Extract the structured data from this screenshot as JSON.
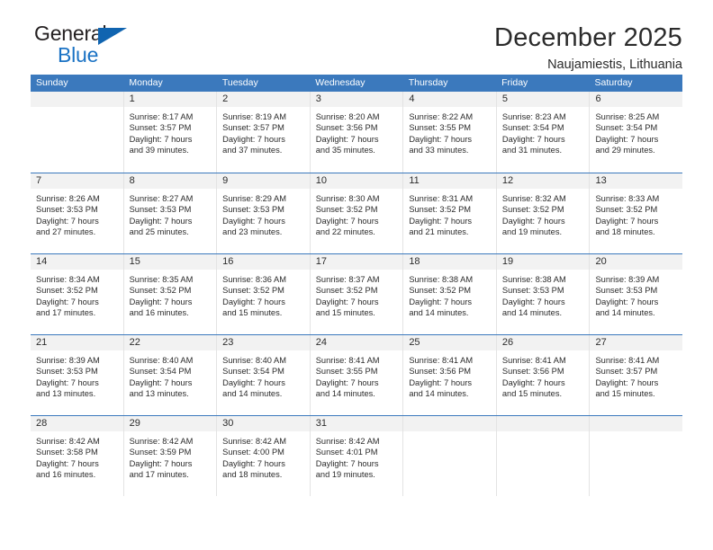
{
  "brand": {
    "name_part1": "General",
    "name_part2": "Blue",
    "triangle_icon": "triangle-icon",
    "accent_color": "#1064b0"
  },
  "header": {
    "title": "December 2025",
    "subtitle": "Naujamiestis, Lithuania"
  },
  "calendar": {
    "header_color": "#3b79bd",
    "day_band_color": "#f2f2f2",
    "weekdays": [
      "Sunday",
      "Monday",
      "Tuesday",
      "Wednesday",
      "Thursday",
      "Friday",
      "Saturday"
    ],
    "weeks": [
      {
        "days": [
          {
            "num": "",
            "empty": true,
            "sunrise": "",
            "sunset": "",
            "daylight_line1": "",
            "daylight_line2": ""
          },
          {
            "num": "1",
            "empty": false,
            "sunrise": "Sunrise: 8:17 AM",
            "sunset": "Sunset: 3:57 PM",
            "daylight_line1": "Daylight: 7 hours",
            "daylight_line2": "and 39 minutes."
          },
          {
            "num": "2",
            "empty": false,
            "sunrise": "Sunrise: 8:19 AM",
            "sunset": "Sunset: 3:57 PM",
            "daylight_line1": "Daylight: 7 hours",
            "daylight_line2": "and 37 minutes."
          },
          {
            "num": "3",
            "empty": false,
            "sunrise": "Sunrise: 8:20 AM",
            "sunset": "Sunset: 3:56 PM",
            "daylight_line1": "Daylight: 7 hours",
            "daylight_line2": "and 35 minutes."
          },
          {
            "num": "4",
            "empty": false,
            "sunrise": "Sunrise: 8:22 AM",
            "sunset": "Sunset: 3:55 PM",
            "daylight_line1": "Daylight: 7 hours",
            "daylight_line2": "and 33 minutes."
          },
          {
            "num": "5",
            "empty": false,
            "sunrise": "Sunrise: 8:23 AM",
            "sunset": "Sunset: 3:54 PM",
            "daylight_line1": "Daylight: 7 hours",
            "daylight_line2": "and 31 minutes."
          },
          {
            "num": "6",
            "empty": false,
            "sunrise": "Sunrise: 8:25 AM",
            "sunset": "Sunset: 3:54 PM",
            "daylight_line1": "Daylight: 7 hours",
            "daylight_line2": "and 29 minutes."
          }
        ]
      },
      {
        "days": [
          {
            "num": "7",
            "empty": false,
            "sunrise": "Sunrise: 8:26 AM",
            "sunset": "Sunset: 3:53 PM",
            "daylight_line1": "Daylight: 7 hours",
            "daylight_line2": "and 27 minutes."
          },
          {
            "num": "8",
            "empty": false,
            "sunrise": "Sunrise: 8:27 AM",
            "sunset": "Sunset: 3:53 PM",
            "daylight_line1": "Daylight: 7 hours",
            "daylight_line2": "and 25 minutes."
          },
          {
            "num": "9",
            "empty": false,
            "sunrise": "Sunrise: 8:29 AM",
            "sunset": "Sunset: 3:53 PM",
            "daylight_line1": "Daylight: 7 hours",
            "daylight_line2": "and 23 minutes."
          },
          {
            "num": "10",
            "empty": false,
            "sunrise": "Sunrise: 8:30 AM",
            "sunset": "Sunset: 3:52 PM",
            "daylight_line1": "Daylight: 7 hours",
            "daylight_line2": "and 22 minutes."
          },
          {
            "num": "11",
            "empty": false,
            "sunrise": "Sunrise: 8:31 AM",
            "sunset": "Sunset: 3:52 PM",
            "daylight_line1": "Daylight: 7 hours",
            "daylight_line2": "and 21 minutes."
          },
          {
            "num": "12",
            "empty": false,
            "sunrise": "Sunrise: 8:32 AM",
            "sunset": "Sunset: 3:52 PM",
            "daylight_line1": "Daylight: 7 hours",
            "daylight_line2": "and 19 minutes."
          },
          {
            "num": "13",
            "empty": false,
            "sunrise": "Sunrise: 8:33 AM",
            "sunset": "Sunset: 3:52 PM",
            "daylight_line1": "Daylight: 7 hours",
            "daylight_line2": "and 18 minutes."
          }
        ]
      },
      {
        "days": [
          {
            "num": "14",
            "empty": false,
            "sunrise": "Sunrise: 8:34 AM",
            "sunset": "Sunset: 3:52 PM",
            "daylight_line1": "Daylight: 7 hours",
            "daylight_line2": "and 17 minutes."
          },
          {
            "num": "15",
            "empty": false,
            "sunrise": "Sunrise: 8:35 AM",
            "sunset": "Sunset: 3:52 PM",
            "daylight_line1": "Daylight: 7 hours",
            "daylight_line2": "and 16 minutes."
          },
          {
            "num": "16",
            "empty": false,
            "sunrise": "Sunrise: 8:36 AM",
            "sunset": "Sunset: 3:52 PM",
            "daylight_line1": "Daylight: 7 hours",
            "daylight_line2": "and 15 minutes."
          },
          {
            "num": "17",
            "empty": false,
            "sunrise": "Sunrise: 8:37 AM",
            "sunset": "Sunset: 3:52 PM",
            "daylight_line1": "Daylight: 7 hours",
            "daylight_line2": "and 15 minutes."
          },
          {
            "num": "18",
            "empty": false,
            "sunrise": "Sunrise: 8:38 AM",
            "sunset": "Sunset: 3:52 PM",
            "daylight_line1": "Daylight: 7 hours",
            "daylight_line2": "and 14 minutes."
          },
          {
            "num": "19",
            "empty": false,
            "sunrise": "Sunrise: 8:38 AM",
            "sunset": "Sunset: 3:53 PM",
            "daylight_line1": "Daylight: 7 hours",
            "daylight_line2": "and 14 minutes."
          },
          {
            "num": "20",
            "empty": false,
            "sunrise": "Sunrise: 8:39 AM",
            "sunset": "Sunset: 3:53 PM",
            "daylight_line1": "Daylight: 7 hours",
            "daylight_line2": "and 14 minutes."
          }
        ]
      },
      {
        "days": [
          {
            "num": "21",
            "empty": false,
            "sunrise": "Sunrise: 8:39 AM",
            "sunset": "Sunset: 3:53 PM",
            "daylight_line1": "Daylight: 7 hours",
            "daylight_line2": "and 13 minutes."
          },
          {
            "num": "22",
            "empty": false,
            "sunrise": "Sunrise: 8:40 AM",
            "sunset": "Sunset: 3:54 PM",
            "daylight_line1": "Daylight: 7 hours",
            "daylight_line2": "and 13 minutes."
          },
          {
            "num": "23",
            "empty": false,
            "sunrise": "Sunrise: 8:40 AM",
            "sunset": "Sunset: 3:54 PM",
            "daylight_line1": "Daylight: 7 hours",
            "daylight_line2": "and 14 minutes."
          },
          {
            "num": "24",
            "empty": false,
            "sunrise": "Sunrise: 8:41 AM",
            "sunset": "Sunset: 3:55 PM",
            "daylight_line1": "Daylight: 7 hours",
            "daylight_line2": "and 14 minutes."
          },
          {
            "num": "25",
            "empty": false,
            "sunrise": "Sunrise: 8:41 AM",
            "sunset": "Sunset: 3:56 PM",
            "daylight_line1": "Daylight: 7 hours",
            "daylight_line2": "and 14 minutes."
          },
          {
            "num": "26",
            "empty": false,
            "sunrise": "Sunrise: 8:41 AM",
            "sunset": "Sunset: 3:56 PM",
            "daylight_line1": "Daylight: 7 hours",
            "daylight_line2": "and 15 minutes."
          },
          {
            "num": "27",
            "empty": false,
            "sunrise": "Sunrise: 8:41 AM",
            "sunset": "Sunset: 3:57 PM",
            "daylight_line1": "Daylight: 7 hours",
            "daylight_line2": "and 15 minutes."
          }
        ]
      },
      {
        "days": [
          {
            "num": "28",
            "empty": false,
            "sunrise": "Sunrise: 8:42 AM",
            "sunset": "Sunset: 3:58 PM",
            "daylight_line1": "Daylight: 7 hours",
            "daylight_line2": "and 16 minutes."
          },
          {
            "num": "29",
            "empty": false,
            "sunrise": "Sunrise: 8:42 AM",
            "sunset": "Sunset: 3:59 PM",
            "daylight_line1": "Daylight: 7 hours",
            "daylight_line2": "and 17 minutes."
          },
          {
            "num": "30",
            "empty": false,
            "sunrise": "Sunrise: 8:42 AM",
            "sunset": "Sunset: 4:00 PM",
            "daylight_line1": "Daylight: 7 hours",
            "daylight_line2": "and 18 minutes."
          },
          {
            "num": "31",
            "empty": false,
            "sunrise": "Sunrise: 8:42 AM",
            "sunset": "Sunset: 4:01 PM",
            "daylight_line1": "Daylight: 7 hours",
            "daylight_line2": "and 19 minutes."
          },
          {
            "num": "",
            "empty": true,
            "sunrise": "",
            "sunset": "",
            "daylight_line1": "",
            "daylight_line2": ""
          },
          {
            "num": "",
            "empty": true,
            "sunrise": "",
            "sunset": "",
            "daylight_line1": "",
            "daylight_line2": ""
          },
          {
            "num": "",
            "empty": true,
            "sunrise": "",
            "sunset": "",
            "daylight_line1": "",
            "daylight_line2": ""
          }
        ]
      }
    ]
  }
}
